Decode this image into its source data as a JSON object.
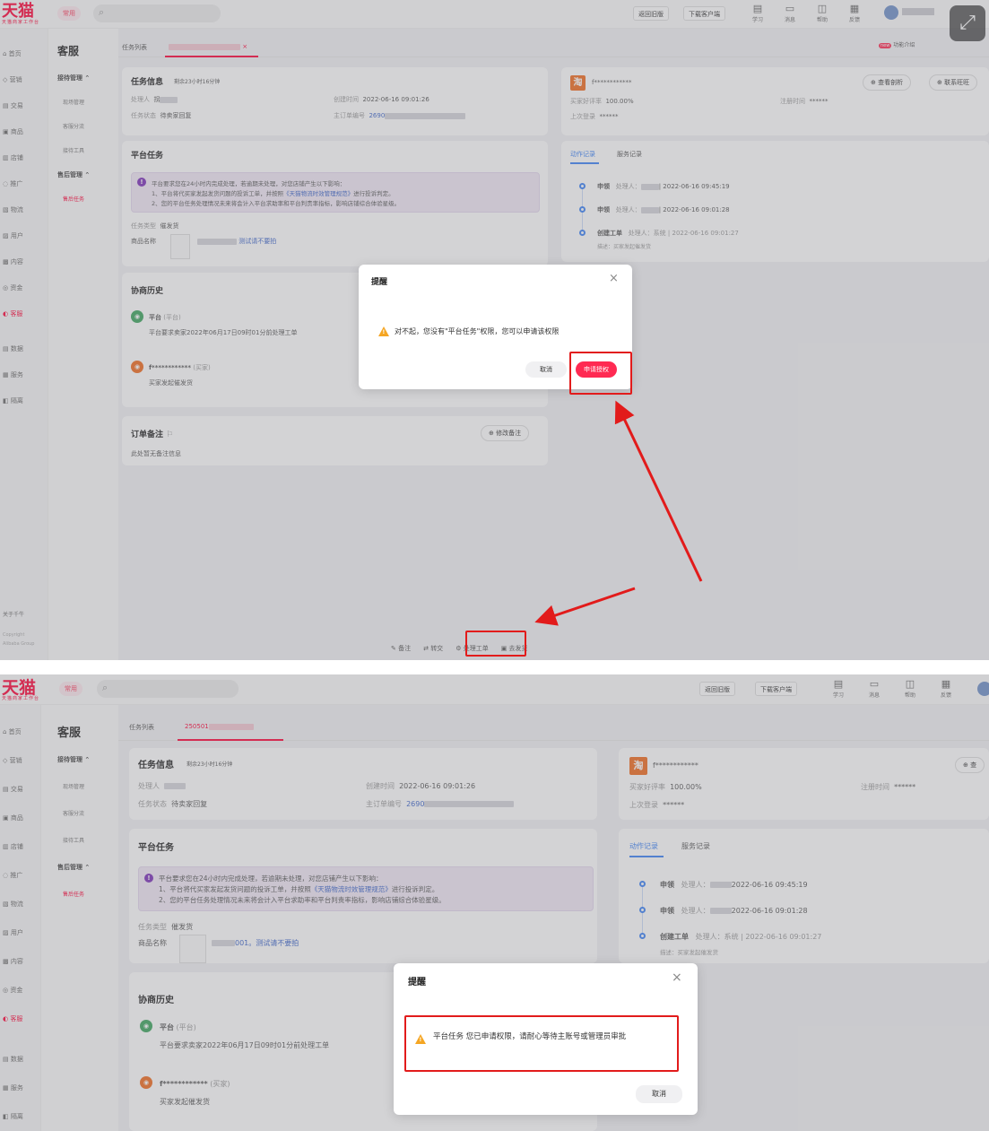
{
  "app": {
    "logo": "天猫",
    "logo_sub": "天猫商家工作台",
    "quick": "常用",
    "btn_old": "返回旧版",
    "btn_client": "下载客户端"
  },
  "top_icons": [
    {
      "name": "学习",
      "icon": "book-icon"
    },
    {
      "name": "消息",
      "icon": "message-icon"
    },
    {
      "name": "帮助",
      "icon": "help-icon"
    },
    {
      "name": "反馈",
      "icon": "feedback-icon"
    }
  ],
  "sidebar": [
    "首页",
    "营销",
    "交易",
    "商品",
    "店铺",
    "推广",
    "物流",
    "用户",
    "内容",
    "资金",
    "客服",
    "数据",
    "服务",
    "隔离"
  ],
  "sidebar_footer": {
    "about": "关于千牛",
    "copyright": "Copyright",
    "group": "Alibaba Group"
  },
  "sub": {
    "title": "客服",
    "group1": "接待管理",
    "group1_items": [
      "现场管理",
      "客服分流",
      "接待工具"
    ],
    "group2": "售后管理",
    "group2_items": [
      "售后任务"
    ]
  },
  "tabs": {
    "list": "任务列表",
    "active_s2": "250501"
  },
  "right_top": {
    "new_badge": "new",
    "guide": "功能介绍"
  },
  "task_info": {
    "title": "任务信息",
    "remaining": "剩余23小时16分钟",
    "handler_label": "处理人",
    "handler_value_s1": "拐",
    "status_label": "任务状态",
    "status_value": "待卖家回复",
    "created_label": "创建时间",
    "created_value": "2022-06-16 09:01:26",
    "order_label": "主订单编号",
    "order_value": "2690"
  },
  "platform_task": {
    "title": "平台任务",
    "notice_line1": "平台要求您在24小时内完成处理，若逾期未处理，对您店铺产生以下影响：",
    "notice_line2_a": "1、平台将代买家发起发货问题的投诉工单，并按照",
    "notice_line2_link": "《天猫物流时效管理规范》",
    "notice_line2_b": "进行投诉判定。",
    "notice_line3": "2、您的平台任务处理情况未来将会计入平台求助率和平台判责率指标，影响店铺综合体验星级。",
    "type_label": "任务类型",
    "type_value": "催发货",
    "product_label": "商品名称",
    "product_link_s1": "测试请不要拍",
    "product_link_s2": "001。测试请不要拍"
  },
  "history": {
    "title": "协商历史",
    "item1_name": "平台",
    "item1_tag": "(平台)",
    "item1_text": "平台要求卖家2022年06月17日09时01分前处理工单",
    "item2_name": "f************",
    "item2_tag": "(买家)",
    "item2_text": "买家发起催发货"
  },
  "remark": {
    "title": "订单备注",
    "edit": "修改备注",
    "empty": "此处暂无备注信息"
  },
  "buyer": {
    "logo": "淘",
    "name": "f************",
    "rate_label": "买家好评率",
    "rate_value": "100.00%",
    "last_label": "上次登录",
    "last_value": "******",
    "reg_label": "注册时间",
    "reg_value": "******",
    "btn_view": "查看剖析",
    "btn_contact": "联系旺旺",
    "btn_view_s2": "查"
  },
  "records": {
    "tab1": "动作记录",
    "tab2": "服务记录",
    "items": [
      {
        "action": "申领",
        "text": "处理人：",
        "time": "2022-06-16 09:45:19"
      },
      {
        "action": "申领",
        "text": "处理人：",
        "time": "2022-06-16 09:01:28"
      },
      {
        "action": "创建工单",
        "text": "处理人：系统 | 2022-06-16 09:01:27",
        "time": "",
        "note": "描述：买家发起催发货"
      }
    ]
  },
  "bottom_actions": [
    "备注",
    "转交",
    "处理工单",
    "去发货"
  ],
  "modal1": {
    "title": "提醒",
    "message": "对不起，您没有\"平台任务\"权限，您可以申请该权限",
    "cancel": "取消",
    "apply": "申请授权"
  },
  "modal2": {
    "title": "提醒",
    "message": "平台任务 您已申请权限，请耐心等待主账号或管理员审批",
    "cancel": "取消"
  },
  "colors": {
    "brand": "#ff0036",
    "annotation": "#e21b1b",
    "notice_bg": "#f1e9f6",
    "link": "#3a63c9"
  }
}
